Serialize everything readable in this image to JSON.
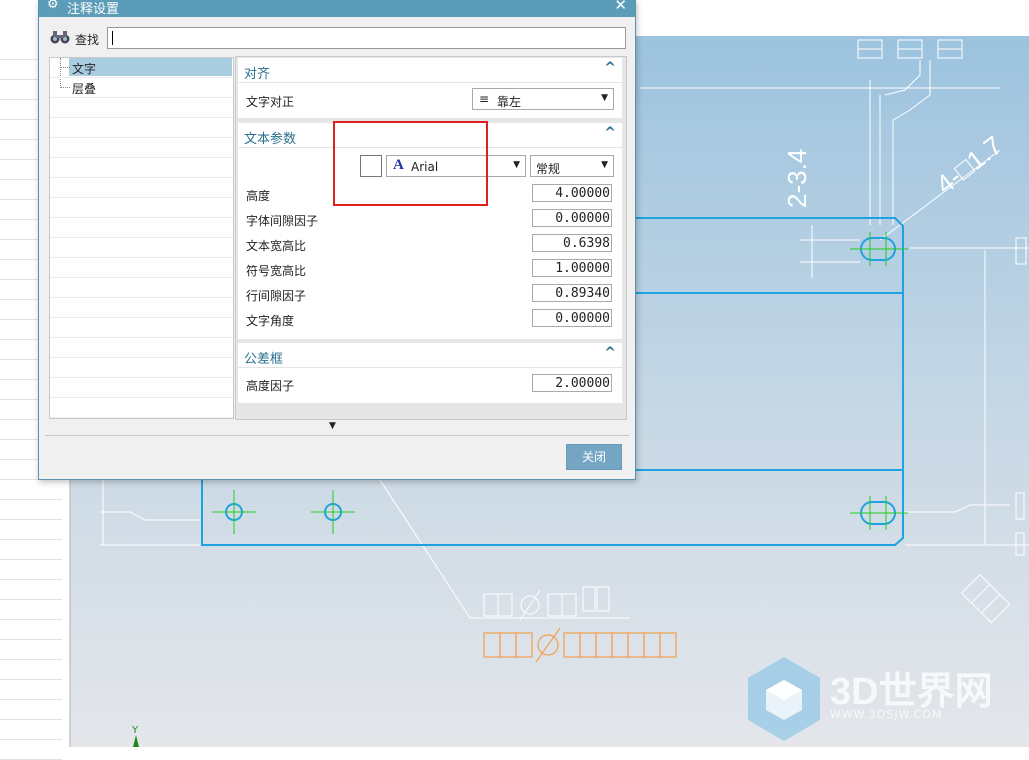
{
  "dialog": {
    "title": "注释设置",
    "find_label": "查找",
    "find_value": "",
    "tree": [
      "文字",
      "层叠"
    ],
    "sections": {
      "align": {
        "title": "对齐",
        "text_align_label": "文字对正",
        "text_align_value": "靠左"
      },
      "text_params": {
        "title": "文本参数",
        "font": "Arial",
        "style": "常规",
        "fields": [
          {
            "label": "高度",
            "value": "4.00000"
          },
          {
            "label": "字体间隙因子",
            "value": "0.00000"
          },
          {
            "label": "文本宽高比",
            "value": "0.6398"
          },
          {
            "label": "符号宽高比",
            "value": "1.00000"
          },
          {
            "label": "行间隙因子",
            "value": "0.89340"
          },
          {
            "label": "文字角度",
            "value": "0.00000"
          }
        ]
      },
      "tolerance_frame": {
        "title": "公差框",
        "height_factor_label": "高度因子",
        "height_factor_value": "2.00000"
      }
    },
    "close_label": "关闭"
  },
  "drawing": {
    "dim_vertical": "2-3.4",
    "dim_angled": "4-□1.7",
    "axis_label": "Y"
  },
  "watermark": {
    "brand": "3D世界网",
    "url": "WWW.3DSJW.COM"
  },
  "colors": {
    "titlebar": "#5b9cb8",
    "outline": "#1fa3e0",
    "center_mark": "#22cc22",
    "annotation_orange": "#f0a050",
    "highlight_red": "#e0201c"
  }
}
